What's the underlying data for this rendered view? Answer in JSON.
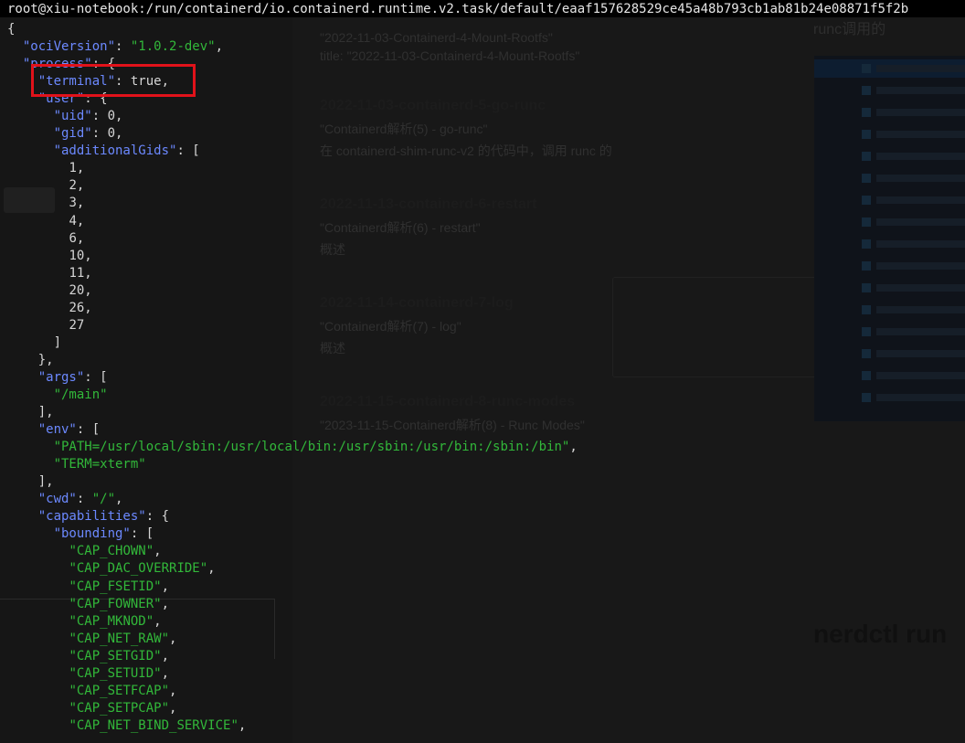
{
  "terminal": {
    "title": "root@xiu-notebook:/run/containerd/io.containerd.runtime.v2.task/default/eaaf157628529ce45a48b793cb1ab81b24e08871f5f2b",
    "json_lines": [
      {
        "indent": 0,
        "open": "{"
      },
      {
        "indent": 1,
        "key": "ociVersion",
        "value": "\"1.0.2-dev\"",
        "type": "string",
        "suffix": ","
      },
      {
        "indent": 1,
        "key": "process",
        "open": "{"
      },
      {
        "indent": 2,
        "key": "terminal",
        "value": "true",
        "type": "bool",
        "suffix": ","
      },
      {
        "indent": 2,
        "key": "user",
        "open": "{"
      },
      {
        "indent": 3,
        "key": "uid",
        "value": "0",
        "type": "num",
        "suffix": ","
      },
      {
        "indent": 3,
        "key": "gid",
        "value": "0",
        "type": "num",
        "suffix": ","
      },
      {
        "indent": 3,
        "key": "additionalGids",
        "open": "["
      },
      {
        "indent": 4,
        "value": "1",
        "type": "num",
        "suffix": ","
      },
      {
        "indent": 4,
        "value": "2",
        "type": "num",
        "suffix": ","
      },
      {
        "indent": 4,
        "value": "3",
        "type": "num",
        "suffix": ","
      },
      {
        "indent": 4,
        "value": "4",
        "type": "num",
        "suffix": ","
      },
      {
        "indent": 4,
        "value": "6",
        "type": "num",
        "suffix": ","
      },
      {
        "indent": 4,
        "value": "10",
        "type": "num",
        "suffix": ","
      },
      {
        "indent": 4,
        "value": "11",
        "type": "num",
        "suffix": ","
      },
      {
        "indent": 4,
        "value": "20",
        "type": "num",
        "suffix": ","
      },
      {
        "indent": 4,
        "value": "26",
        "type": "num",
        "suffix": ","
      },
      {
        "indent": 4,
        "value": "27",
        "type": "num",
        "suffix": ""
      },
      {
        "indent": 3,
        "close": "]"
      },
      {
        "indent": 2,
        "close": "},"
      },
      {
        "indent": 2,
        "key": "args",
        "open": "["
      },
      {
        "indent": 3,
        "value": "\"/main\"",
        "type": "string",
        "suffix": ""
      },
      {
        "indent": 2,
        "close": "],"
      },
      {
        "indent": 2,
        "key": "env",
        "open": "["
      },
      {
        "indent": 3,
        "value": "\"PATH=/usr/local/sbin:/usr/local/bin:/usr/sbin:/usr/bin:/sbin:/bin\"",
        "type": "string",
        "suffix": ","
      },
      {
        "indent": 3,
        "value": "\"TERM=xterm\"",
        "type": "string",
        "suffix": ""
      },
      {
        "indent": 2,
        "close": "],"
      },
      {
        "indent": 2,
        "key": "cwd",
        "value": "\"/\"",
        "type": "string",
        "suffix": ","
      },
      {
        "indent": 2,
        "key": "capabilities",
        "open": "{"
      },
      {
        "indent": 3,
        "key": "bounding",
        "open": "["
      },
      {
        "indent": 4,
        "value": "\"CAP_CHOWN\"",
        "type": "string",
        "suffix": ","
      },
      {
        "indent": 4,
        "value": "\"CAP_DAC_OVERRIDE\"",
        "type": "string",
        "suffix": ","
      },
      {
        "indent": 4,
        "value": "\"CAP_FSETID\"",
        "type": "string",
        "suffix": ","
      },
      {
        "indent": 4,
        "value": "\"CAP_FOWNER\"",
        "type": "string",
        "suffix": ","
      },
      {
        "indent": 4,
        "value": "\"CAP_MKNOD\"",
        "type": "string",
        "suffix": ","
      },
      {
        "indent": 4,
        "value": "\"CAP_NET_RAW\"",
        "type": "string",
        "suffix": ","
      },
      {
        "indent": 4,
        "value": "\"CAP_SETGID\"",
        "type": "string",
        "suffix": ","
      },
      {
        "indent": 4,
        "value": "\"CAP_SETUID\"",
        "type": "string",
        "suffix": ","
      },
      {
        "indent": 4,
        "value": "\"CAP_SETFCAP\"",
        "type": "string",
        "suffix": ","
      },
      {
        "indent": 4,
        "value": "\"CAP_SETPCAP\"",
        "type": "string",
        "suffix": ","
      },
      {
        "indent": 4,
        "value": "\"CAP_NET_BIND_SERVICE\"",
        "type": "string",
        "suffix": ","
      }
    ],
    "highlight_color": "#e1121a",
    "key_color": "#6c89ff",
    "string_color": "#32b83a"
  },
  "blog": {
    "posts": [
      {
        "title": "",
        "sub": "\"2022-11-03-Containerd-4-Mount-Rootfs\"",
        "sub2": "title: \"2022-11-03-Containerd-4-Mount-Rootfs\""
      },
      {
        "title": "2022-11-03-containerd-5-go-runc",
        "sub": "\"Containerd解析(5) - go-runc\"",
        "sub2": "在 containerd-shim-runc-v2 的代码中，调用 runc 的"
      },
      {
        "title": "2022-11-13-containerd-6-restart",
        "sub": "\"Containerd解析(6) - restart\"",
        "sub2": "概述"
      },
      {
        "title": "2022-11-14-containerd-7-log",
        "sub": "\"Containerd解析(7) - log\"",
        "sub2": "概述"
      },
      {
        "title": "2022-11-15-containerd-8-runc-modes",
        "sub": "\"2023-11-15-Containerd解析(8) - Runc Modes\"",
        "sub2": ""
      }
    ],
    "toc_heading": "runc调用的",
    "side_heading": "nerdctl run"
  }
}
